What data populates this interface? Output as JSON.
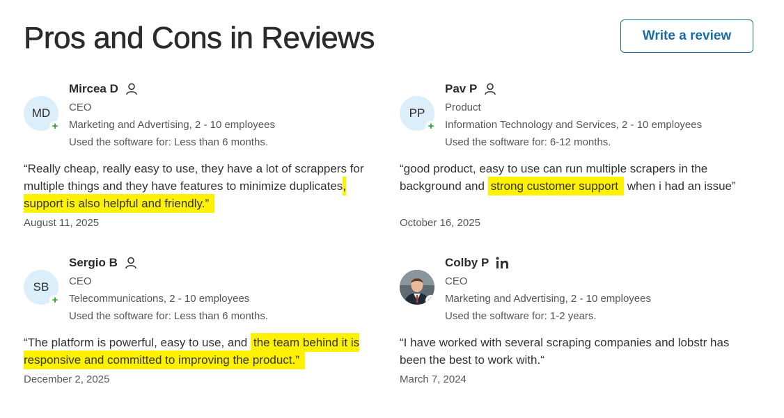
{
  "page": {
    "title": "Pros and Cons in Reviews"
  },
  "header": {
    "write_review_label": "Write a review"
  },
  "reviews": [
    {
      "avatar_initials": "MD",
      "name": "Mircea D",
      "badge_icon": "person-icon",
      "role": "CEO",
      "industry": "Marketing and Advertising, 2 - 10 employees",
      "usage": "Used the software for: Less than 6 months.",
      "quote_plain": "“Really cheap, really easy to use, they have a lot of scrappers for multiple things and they have features to minimize duplicates",
      "quote_highlight": ", support is also helpful and friendly.”",
      "quote_after": "",
      "date": "August 11, 2025"
    },
    {
      "avatar_initials": "PP",
      "name": "Pav P",
      "badge_icon": "person-icon",
      "role": "Product",
      "industry": "Information Technology and Services, 2 - 10 employees",
      "usage": "Used the software for: 6-12 months.",
      "quote_plain": "“good product, easy to use can run multiple scrapers in the background and",
      "quote_highlight": "strong customer support",
      "quote_after": "when i had an issue”",
      "date": "October 16, 2025"
    },
    {
      "avatar_initials": "SB",
      "name": "Sergio B",
      "badge_icon": "person-icon",
      "role": "CEO",
      "industry": "Telecommunications, 2 - 10 employees",
      "usage": "Used the software for: Less than 6 months.",
      "quote_plain": "“The platform is powerful, easy to use, and",
      "quote_highlight": "the team behind it is responsive and committed to improving the product.”",
      "quote_after": "",
      "date": "December 2, 2025"
    },
    {
      "avatar_initials": "",
      "name": "Colby P",
      "badge_icon": "linkedin-icon",
      "role": "CEO",
      "industry": "Marketing and Advertising, 2 - 10 employees",
      "usage": "Used the software for: 1-2 years.",
      "quote_plain": "“I have worked with several scraping companies and lobstr has been the best to work with.“",
      "quote_highlight": "",
      "quote_after": "",
      "date": "March 7, 2024"
    }
  ],
  "colors": {
    "accent": "#1b6aa8",
    "highlight": "#fff200",
    "avatar_bg": "#dbeef9",
    "plus_green": "#2aa035"
  }
}
